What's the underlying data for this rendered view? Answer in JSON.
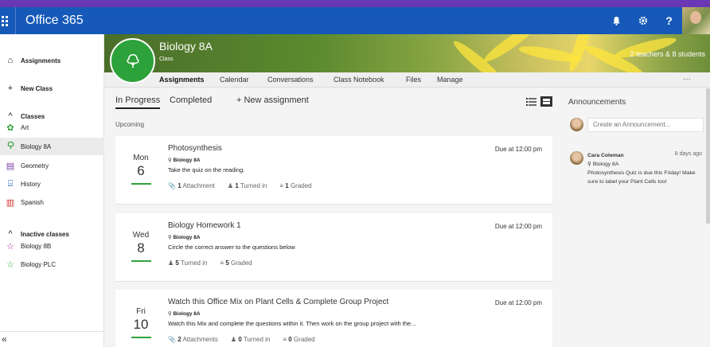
{
  "topbar": {
    "app_name": "Office 365",
    "bell_icon": "bell",
    "settings_icon": "gear",
    "help_label": "?"
  },
  "sidebar": {
    "items": [
      {
        "icon": "home-icon",
        "glyph": "⌂",
        "label": "Assignments"
      },
      {
        "icon": "plus-icon",
        "glyph": "+",
        "label": "New Class"
      }
    ],
    "classes_header": "Classes",
    "classes": [
      {
        "label": "Art",
        "glyph": "✿",
        "color": "#2ea23a"
      },
      {
        "label": "Biology 8A",
        "glyph": "⚲",
        "color": "#2ea23a"
      },
      {
        "label": "Geometry",
        "glyph": "▤",
        "color": "#7b3fa0"
      },
      {
        "label": "History",
        "glyph": "⌸",
        "color": "#1659b8"
      },
      {
        "label": "Spanish",
        "glyph": "▥",
        "color": "#d0312d"
      }
    ],
    "inactive_header": "Inactive classes",
    "inactive": [
      {
        "label": "Biology 8B",
        "glyph": "☆",
        "color": "#b5179e"
      },
      {
        "label": "Biology PLC",
        "glyph": "☆",
        "color": "#2ea23a"
      }
    ],
    "collapse_label": "«"
  },
  "header": {
    "class_name": "Biology 8A",
    "class_type": "Class",
    "counts": "2 teachers & 8 students"
  },
  "tabs": {
    "items": [
      "Assignments",
      "Calendar",
      "Conversations",
      "Class Notebook",
      "Files",
      "Manage"
    ],
    "more": "···"
  },
  "filters": {
    "in_progress": "In Progress",
    "completed": "Completed",
    "new_assignment": "+ New assignment"
  },
  "upcoming_label": "Upcoming",
  "assignments": [
    {
      "day": "Mon",
      "date": "6",
      "title": "Photosynthesis",
      "class": "Biology 8A",
      "desc": "Take the quiz on the reading.",
      "due": "Due at 12:00 pm",
      "attachments": "1",
      "attachments_label": "Attachment",
      "turned_in": "1",
      "turned_in_label": "Turned in",
      "graded": "1",
      "graded_label": "Graded"
    },
    {
      "day": "Wed",
      "date": "8",
      "title": "Biology Homework 1",
      "class": "Biology 8A",
      "desc": "Circle the correct answer to the questions below",
      "due": "Due at 12:00 pm",
      "turned_in": "5",
      "turned_in_label": "Turned in",
      "graded": "5",
      "graded_label": "Graded"
    },
    {
      "day": "Fri",
      "date": "10",
      "title": "Watch this Office Mix on Plant Cells & Complete Group Project",
      "class": "Biology 8A",
      "desc": "Watch this Mix and complete the questions within it. Then work on the group project with the...",
      "due": "Due at 12:00 pm",
      "attachments": "2",
      "attachments_label": "Attachments",
      "turned_in": "0",
      "turned_in_label": "Turned in",
      "graded": "0",
      "graded_label": "Graded"
    }
  ],
  "announcements": {
    "title": "Announcements",
    "placeholder": "Create an Announcement...",
    "post": {
      "author": "Cara Coleman",
      "ago": "8 days ago",
      "class": "Biology 8A",
      "text": "Photosynthesis Quiz is due this Friday! Make sure to label your Plant Cells too!"
    }
  },
  "colors": {
    "topbar": "#1659b8",
    "accent_top": "#6a38b5",
    "class_green": "#2ea23a"
  }
}
